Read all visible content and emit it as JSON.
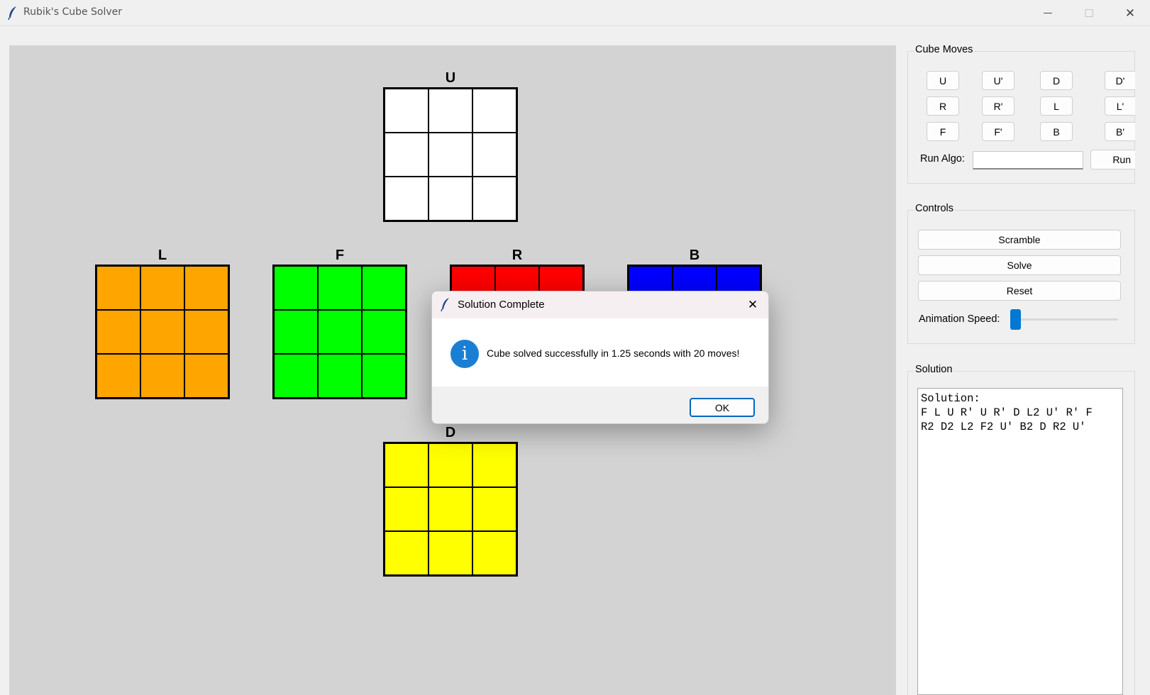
{
  "window": {
    "title": "Rubik's Cube Solver",
    "minimize_glyph": "—",
    "maximize_glyph": "☐",
    "close_glyph": "✕"
  },
  "cube": {
    "faces": [
      {
        "id": "U",
        "label": "U",
        "color": "#ffffff"
      },
      {
        "id": "L",
        "label": "L",
        "color": "#ffa500"
      },
      {
        "id": "F",
        "label": "F",
        "color": "#00ff00"
      },
      {
        "id": "R",
        "label": "R",
        "color": "#ff0000"
      },
      {
        "id": "B",
        "label": "B",
        "color": "#0000ff"
      },
      {
        "id": "D",
        "label": "D",
        "color": "#ffff00"
      }
    ]
  },
  "moves_panel": {
    "title": "Cube Moves",
    "buttons": [
      "U",
      "U'",
      "D",
      "D'",
      "R",
      "R'",
      "L",
      "L'",
      "F",
      "F'",
      "B",
      "B'"
    ],
    "run_algo_label": "Run Algo:",
    "run_algo_value": "",
    "run_button": "Run"
  },
  "controls_panel": {
    "title": "Controls",
    "scramble": "Scramble",
    "solve": "Solve",
    "reset": "Reset",
    "speed_label": "Animation Speed:",
    "speed_level": 0.0
  },
  "solution_panel": {
    "title": "Solution",
    "text": "Solution:\nF L U R' U R' D L2 U' R' F\nR2 D2 L2 F2 U' B2 D R2 U'"
  },
  "dialog": {
    "title": "Solution Complete",
    "message": "Cube solved successfully in 1.25 seconds with 20 moves!",
    "ok": "OK",
    "info_glyph": "i",
    "close_glyph": "✕"
  }
}
